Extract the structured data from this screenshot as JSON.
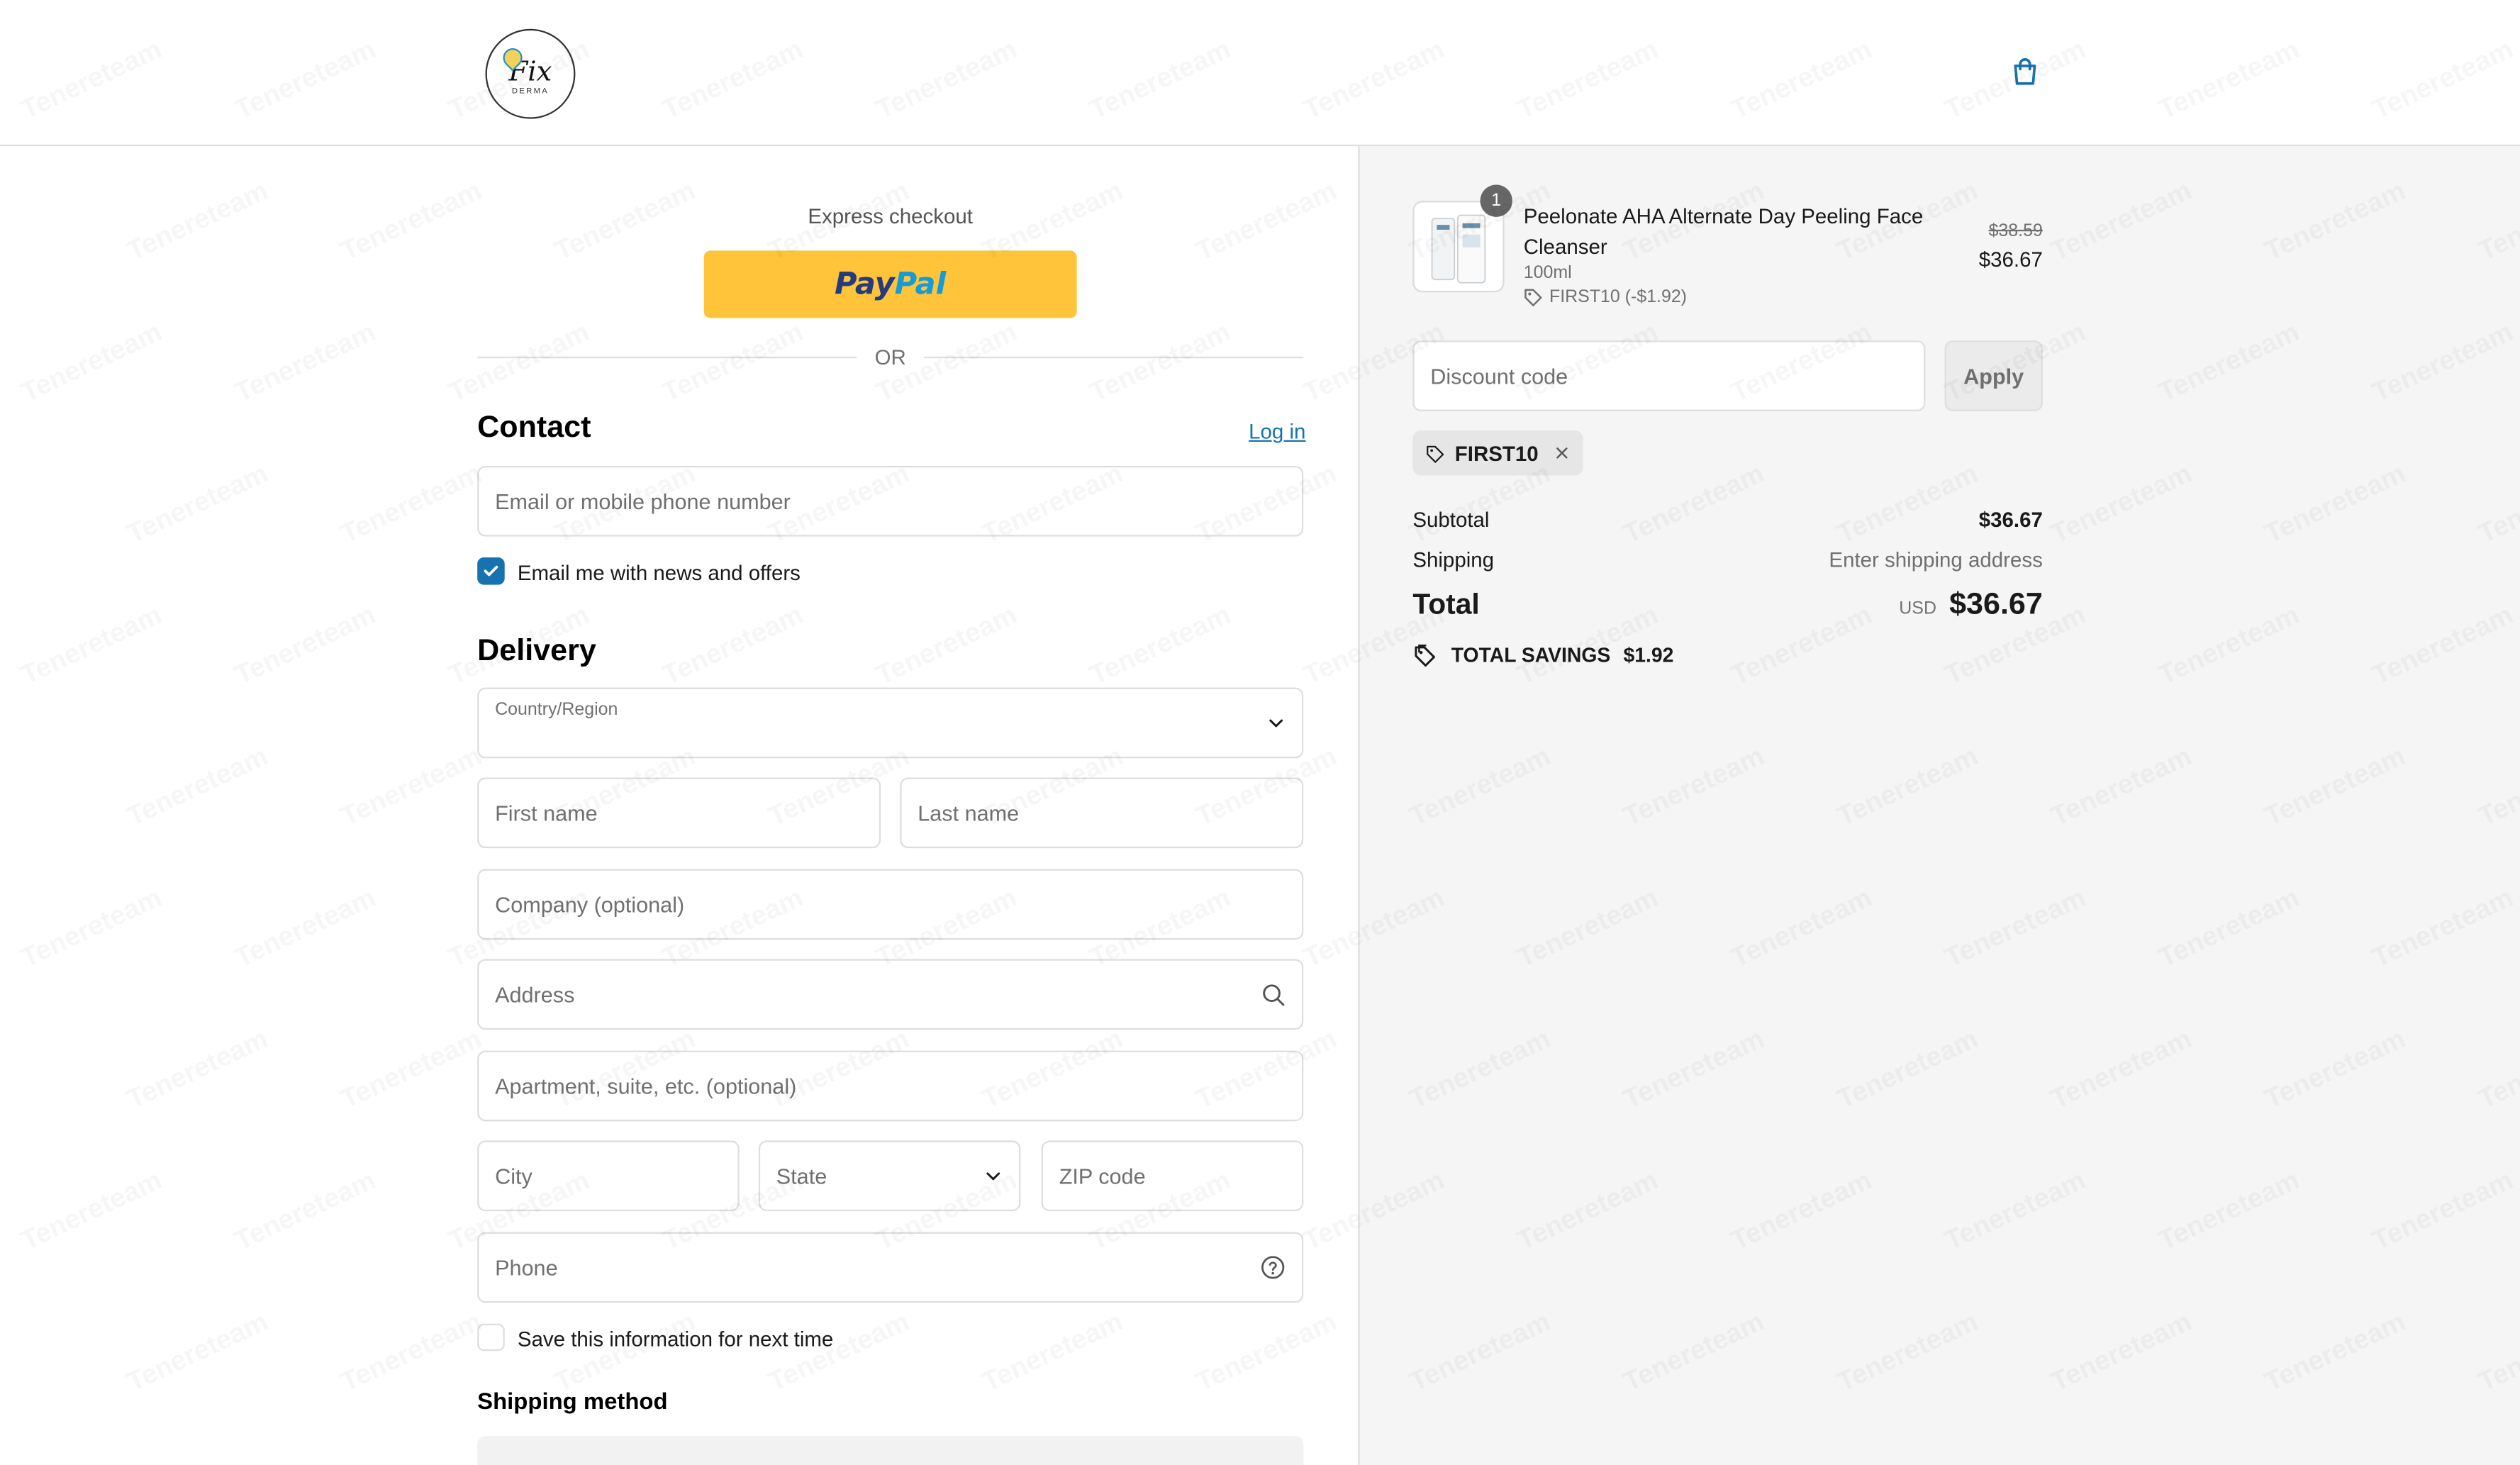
{
  "header": {
    "logo_text": "Fix",
    "logo_subtext": "DERMA",
    "cart_icon": "shopping-bag-icon"
  },
  "express": {
    "title": "Express checkout",
    "paypal_pay": "Pay",
    "paypal_pal": "Pal",
    "or_text": "OR"
  },
  "contact": {
    "heading": "Contact",
    "login_label": "Log in",
    "email_placeholder": "Email or mobile phone number",
    "news_label": "Email me with news and offers",
    "news_checked": true
  },
  "delivery": {
    "heading": "Delivery",
    "country_label": "Country/Region",
    "country_value": "",
    "first_name": "First name",
    "last_name": "Last name",
    "company": "Company (optional)",
    "address": "Address",
    "apartment": "Apartment, suite, etc. (optional)",
    "city": "City",
    "state": "State",
    "zip": "ZIP code",
    "phone": "Phone",
    "save_label": "Save this information for next time",
    "save_checked": false
  },
  "shipping_method": {
    "heading": "Shipping method"
  },
  "order": {
    "quantity": "1",
    "product_name": "Peelonate AHA Alternate Day Peeling Face Cleanser",
    "variant": "100ml",
    "discount_applied": "FIRST10 (-$1.92)",
    "price_old": "$38.59",
    "price_new": "$36.67",
    "discount_placeholder": "Discount code",
    "apply_label": "Apply",
    "code_chip": "FIRST10",
    "subtotal_label": "Subtotal",
    "subtotal_value": "$36.67",
    "shipping_label": "Shipping",
    "shipping_value": "Enter shipping address",
    "total_label": "Total",
    "currency": "USD",
    "total_value": "$36.67",
    "savings_label": "TOTAL SAVINGS",
    "savings_value": "$1.92"
  },
  "watermark": "Tenereteam",
  "colors": {
    "accent": "#1773b0",
    "paypal_yellow": "#ffc439",
    "panel_bg": "#f5f5f5"
  }
}
